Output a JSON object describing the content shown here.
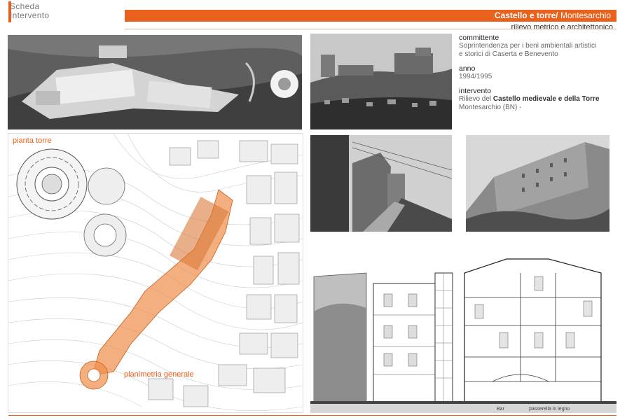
{
  "header": {
    "logo_line1": "Scheda",
    "logo_line2": "Intervento",
    "title_main": "Castello e torre/",
    "title_place": " Montesarchio",
    "subtitle": "rilievo metrico e architettonico"
  },
  "info": {
    "committente_label": "committente",
    "committente_text1": "Soprintendenza per i beni ambientali artistici",
    "committente_text2": "e storici di Caserta e Benevento",
    "anno_label": "anno",
    "anno_value": "1994/1995",
    "intervento_label": "intervento",
    "intervento_prefix": "Rilievo del ",
    "intervento_bold": "Castello medievale e della Torre",
    "intervento_location": "Montesarchio (BN) -"
  },
  "plan": {
    "label_tower": "pianta torre",
    "label_general": "planimetria generale"
  },
  "section": {
    "label_bar": "Bar",
    "label_passerella": "passerella in legno"
  },
  "colors": {
    "accent": "#e8621e"
  }
}
